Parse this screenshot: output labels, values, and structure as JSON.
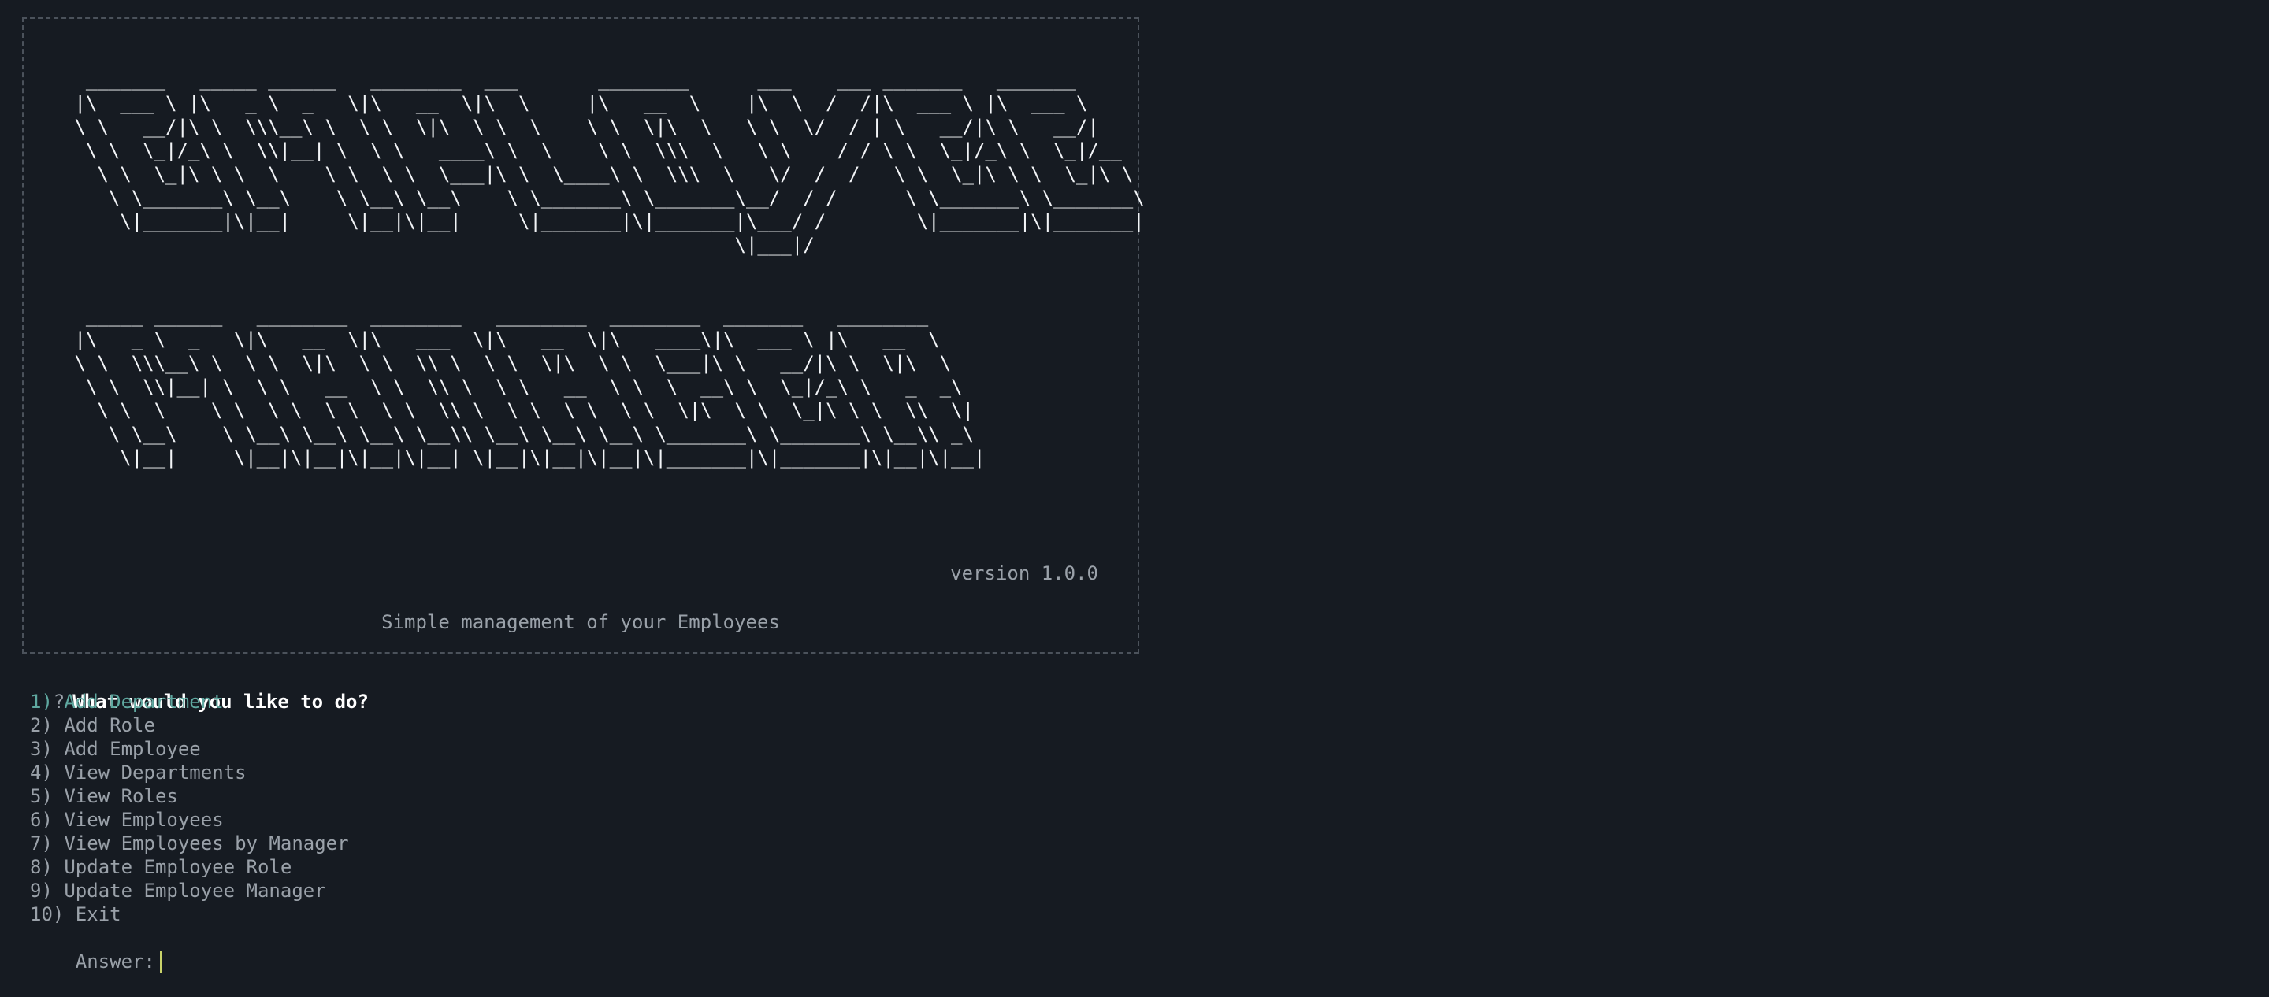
{
  "banner": {
    "title_art": "  _______   _____ ______   ________  ___       ________      ___    ___ _______   _______\n |\\  ___ \\ |\\   _ \\  _   \\|\\   __  \\|\\  \\     |\\   __  \\    |\\  \\  /  /|\\  ___ \\ |\\  ___ \\\n \\ \\   __/|\\ \\  \\\\\\__\\ \\  \\ \\  \\|\\  \\ \\  \\    \\ \\  \\|\\  \\   \\ \\  \\/  / | \\   __/|\\ \\   __/|\n  \\ \\  \\_|/_\\ \\  \\\\|__| \\  \\ \\   ____\\ \\  \\    \\ \\  \\\\\\  \\   \\ \\    / / \\ \\  \\_|/_\\ \\  \\_|/__\n   \\ \\  \\_|\\ \\ \\  \\    \\ \\  \\ \\  \\___|\\ \\  \\____\\ \\  \\\\\\  \\   \\/  /  /   \\ \\  \\_|\\ \\ \\  \\_|\\ \\\n    \\ \\_______\\ \\__\\    \\ \\__\\ \\__\\    \\ \\_______\\ \\_______\\__/  / /      \\ \\_______\\ \\_______\\\n     \\|_______|\\|__|     \\|__|\\|__|     \\|_______|\\|_______|\\___/ /        \\|_______|\\|_______|\n                                                           \\|___|/",
    "subtitle_art": "  _____ ______   ________  ________   ________  ________  _______   ________\n |\\   _ \\  _   \\|\\   __  \\|\\   ___  \\|\\   __  \\|\\   ____\\|\\  ___ \\ |\\   __  \\\n \\ \\  \\\\\\__\\ \\  \\ \\  \\|\\  \\ \\  \\\\ \\  \\ \\  \\|\\  \\ \\  \\___|\\ \\   __/|\\ \\  \\|\\  \\\n  \\ \\  \\\\|__| \\  \\ \\   __  \\ \\  \\\\ \\  \\ \\   __  \\ \\  \\  __\\ \\  \\_|/_\\ \\   _  _\\\n   \\ \\  \\    \\ \\  \\ \\  \\ \\  \\ \\  \\\\ \\  \\ \\  \\ \\  \\ \\  \\|\\  \\ \\  \\_|\\ \\ \\  \\\\  \\|\n    \\ \\__\\    \\ \\__\\ \\__\\ \\__\\ \\__\\\\ \\__\\ \\__\\ \\__\\ \\_______\\ \\_______\\ \\__\\\\ _\\\n     \\|__|     \\|__|\\|__|\\|__|\\|__| \\|__|\\|__|\\|__|\\|_______|\\|_______|\\|__|\\|__|",
    "version": "version 1.0.0",
    "tagline": "Simple management of your Employees"
  },
  "prompt": {
    "qmark": "?",
    "question": "What would you like to do?",
    "options": [
      "1) Add Department",
      "2) Add Role",
      "3) Add Employee",
      "4) View Departments",
      "5) View Roles",
      "6) View Employees",
      "7) View Employees by Manager",
      "8) Update Employee Role",
      "9) Update Employee Manager",
      "10) Exit"
    ],
    "answer_label": "Answer:",
    "answer_value": ""
  },
  "colors": {
    "background": "#161b22",
    "text": "#9aa1a9",
    "bright": "#f2f4f7",
    "highlight": "#5fa8a0",
    "border": "#4b525b",
    "cursor": "#c9d36a"
  }
}
